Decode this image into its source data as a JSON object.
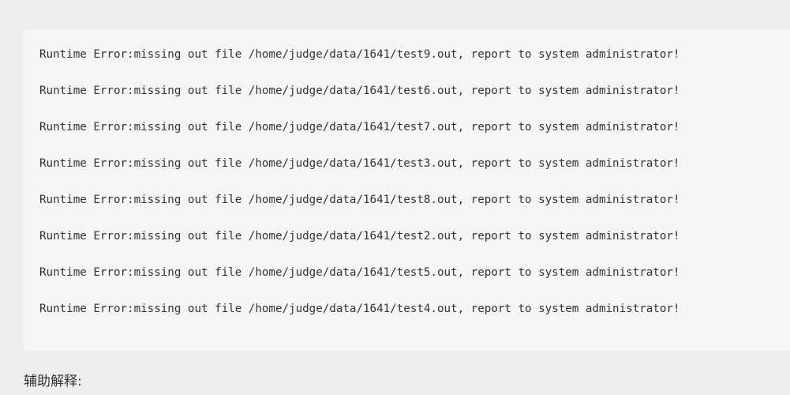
{
  "output": {
    "lines": [
      "Runtime Error:missing out file /home/judge/data/1641/test9.out, report to system administrator!",
      "Runtime Error:missing out file /home/judge/data/1641/test6.out, report to system administrator!",
      "Runtime Error:missing out file /home/judge/data/1641/test7.out, report to system administrator!",
      "Runtime Error:missing out file /home/judge/data/1641/test3.out, report to system administrator!",
      "Runtime Error:missing out file /home/judge/data/1641/test8.out, report to system administrator!",
      "Runtime Error:missing out file /home/judge/data/1641/test2.out, report to system administrator!",
      "Runtime Error:missing out file /home/judge/data/1641/test5.out, report to system administrator!",
      "Runtime Error:missing out file /home/judge/data/1641/test4.out, report to system administrator!"
    ]
  },
  "explanation": {
    "label": "辅助解释:"
  },
  "colors": {
    "page_background": "#eeeeee",
    "box_background": "#f5f5f5",
    "text": "#333333"
  }
}
